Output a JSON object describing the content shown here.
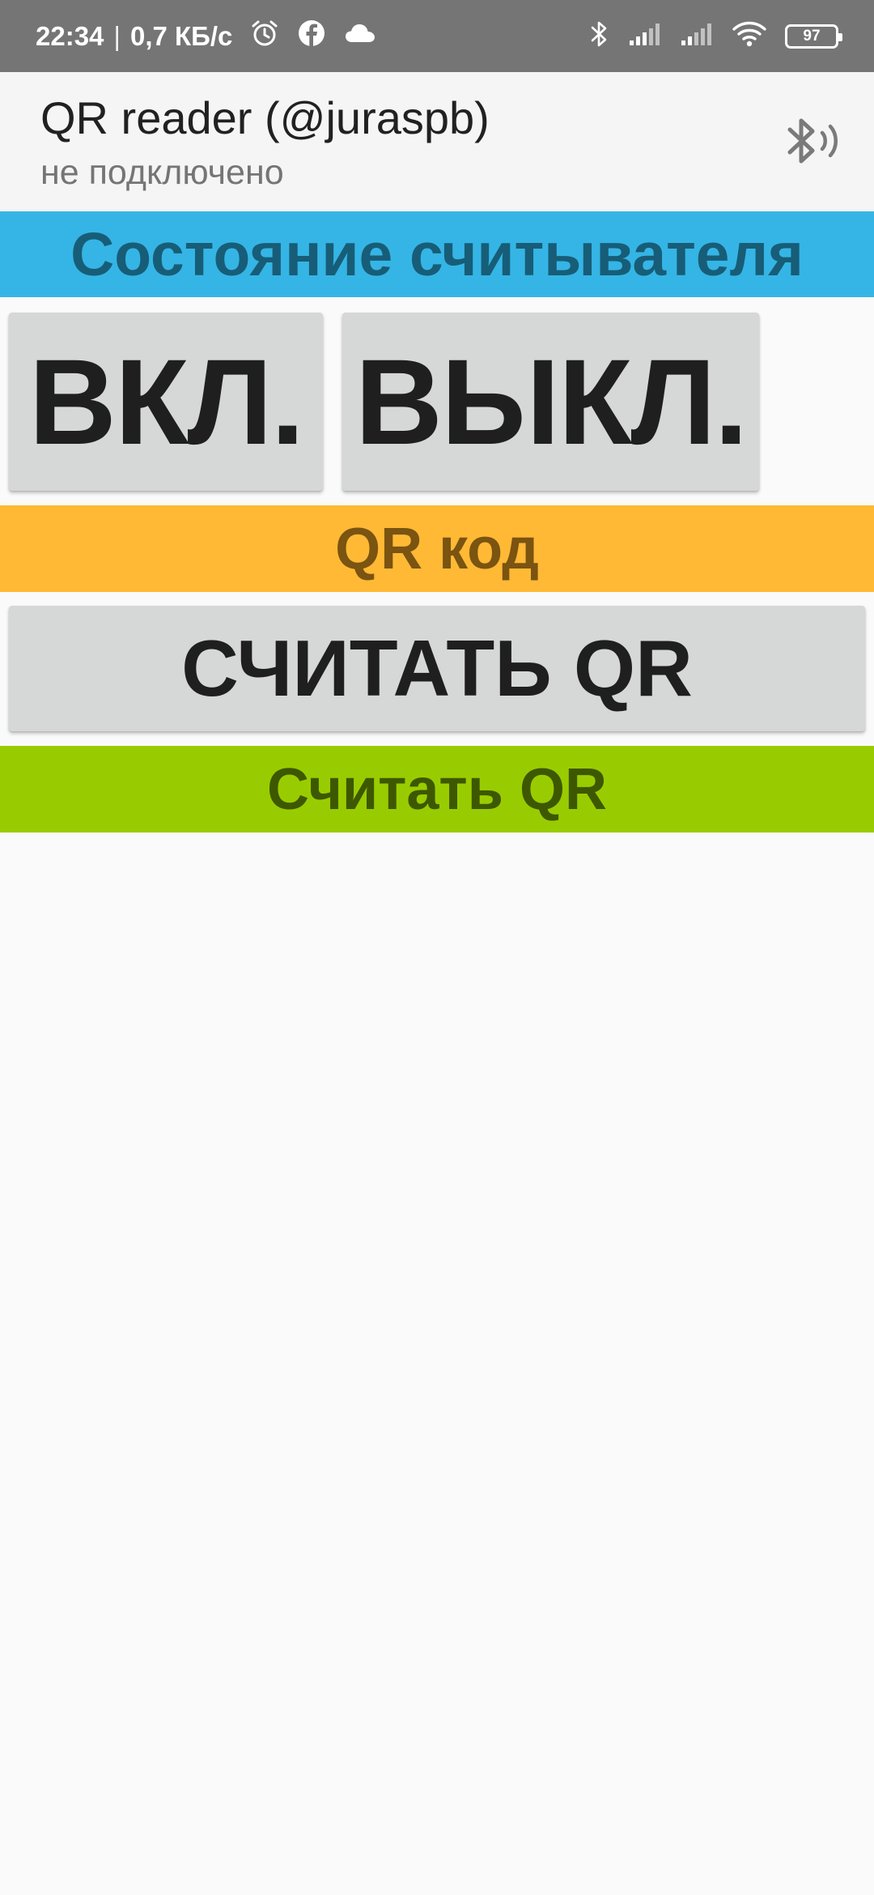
{
  "status_bar": {
    "time": "22:34",
    "separator": "|",
    "network_speed": "0,7 КБ/с",
    "left_icons": [
      "alarm-icon",
      "facebook-icon",
      "cloud-icon"
    ],
    "right_icons": [
      "bluetooth-icon",
      "signal-icon",
      "signal-icon",
      "wifi-icon"
    ],
    "battery_level": "97"
  },
  "app_bar": {
    "title": "QR reader (@juraspb)",
    "subtitle": "не подключено",
    "action_icon": "bluetooth-audio-icon"
  },
  "reader_state": {
    "header": "Состояние считывателя",
    "on_label": "ВКЛ.",
    "off_label": "ВЫКЛ."
  },
  "qr_code": {
    "header": "QR код",
    "scan_label": "СЧИТАТЬ QR"
  },
  "result": {
    "text": "Считать QR"
  },
  "colors": {
    "status_bar": "#757575",
    "app_bar": "#f5f5f5",
    "state_header_bg": "#35b5e5",
    "state_header_text": "#175d78",
    "qr_header_bg": "#ffb935",
    "qr_header_text": "#7a5410",
    "result_bg": "#99cc00",
    "result_text": "#3d5800",
    "button_bg": "#d6d7d7"
  }
}
